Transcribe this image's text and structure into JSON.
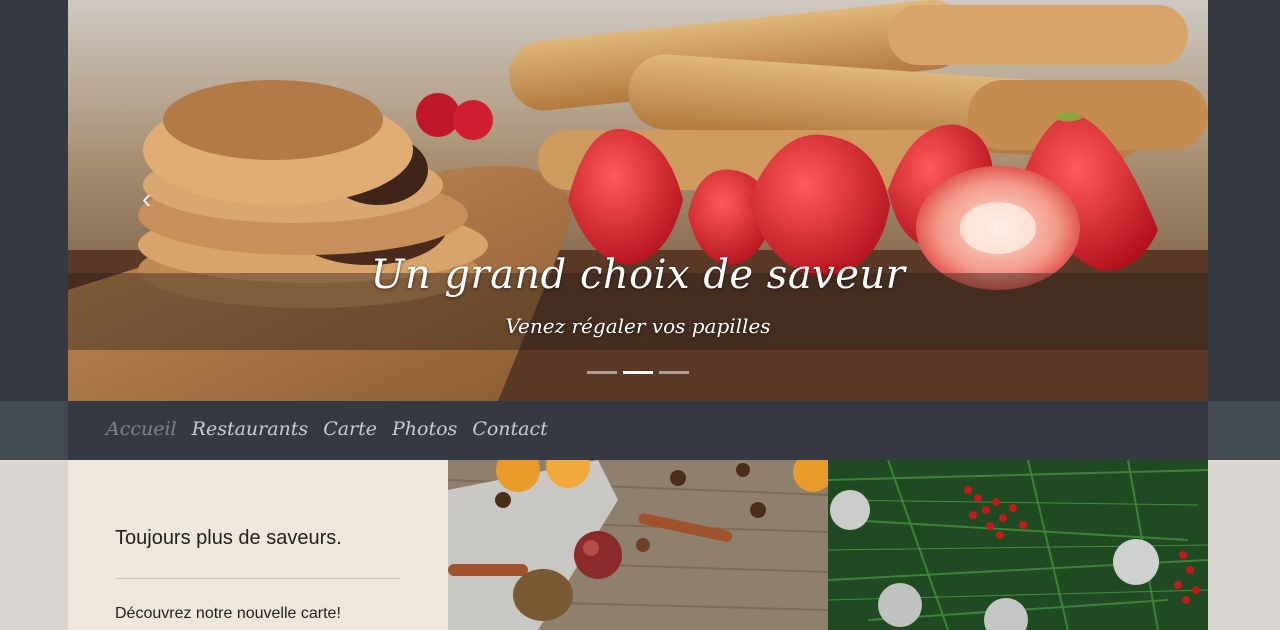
{
  "carousel": {
    "title": "Un grand choix de saveur",
    "subtitle": "Venez régaler vos papilles",
    "prev_icon": "chevron-left-icon",
    "prev_glyph": "‹",
    "slide_count": 3,
    "active_slide": 2
  },
  "nav": {
    "items": [
      {
        "label": "Accueil",
        "active": true
      },
      {
        "label": "Restaurants",
        "active": false
      },
      {
        "label": "Carte",
        "active": false
      },
      {
        "label": "Photos",
        "active": false
      },
      {
        "label": "Contact",
        "active": false
      }
    ]
  },
  "promo": {
    "heading": "Toujours plus de saveurs.",
    "text": "Découvrez notre nouvelle carte!"
  },
  "colors": {
    "page_background": "#d9d6d1",
    "header_band": "#353a42",
    "promo_background": "#efe6dc",
    "nav_text": "#c8cdd3",
    "nav_active_text": "#7b828b"
  }
}
